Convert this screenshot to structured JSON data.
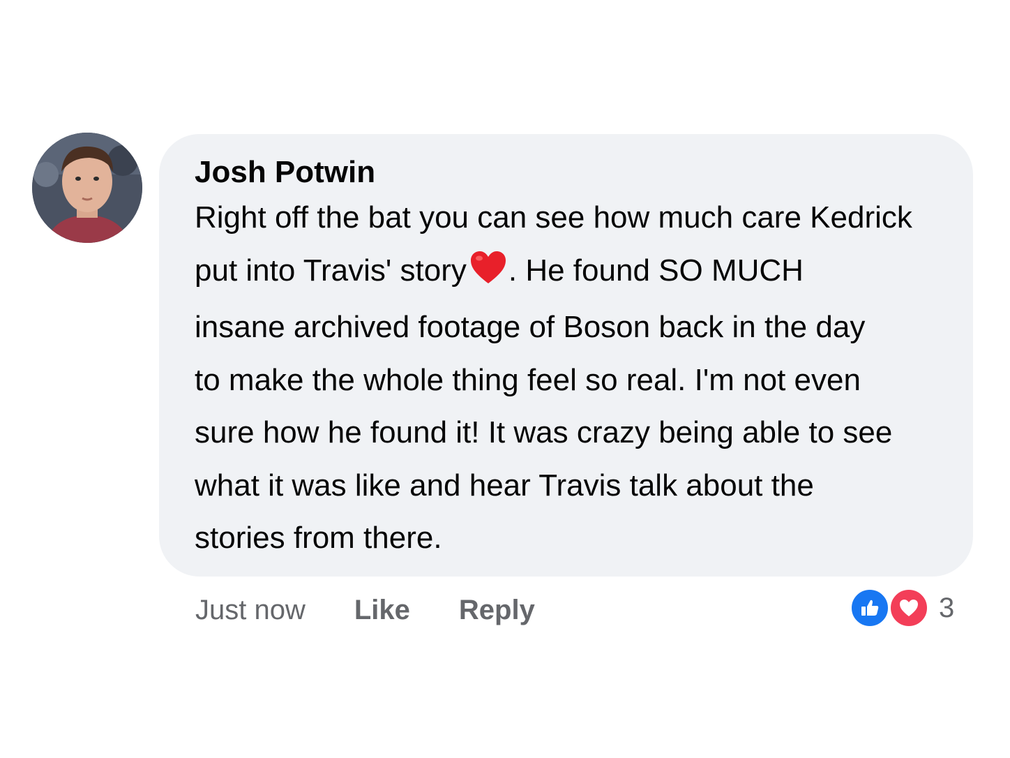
{
  "comment": {
    "author": "Josh Potwin",
    "lines": [
      "Right off the bat you can see how much care Kedrick",
      "put into Travis' story",
      ". He found SO MUCH",
      "insane archived footage of Boson back in the day",
      "to make the whole thing feel so real. I'm not even",
      "sure how he found it! It was crazy being able to see",
      "what it was like and hear Travis talk about the",
      "stories from there."
    ],
    "emoji": "red-heart",
    "timestamp": "Just now",
    "like_label": "Like",
    "reply_label": "Reply",
    "reaction_count": "3",
    "reactions": [
      "like",
      "love"
    ]
  },
  "colors": {
    "bubble": "#f0f2f5",
    "text": "#050505",
    "meta": "#65676b",
    "like_blue": "#1877f2",
    "love_red": "#f33e58"
  }
}
